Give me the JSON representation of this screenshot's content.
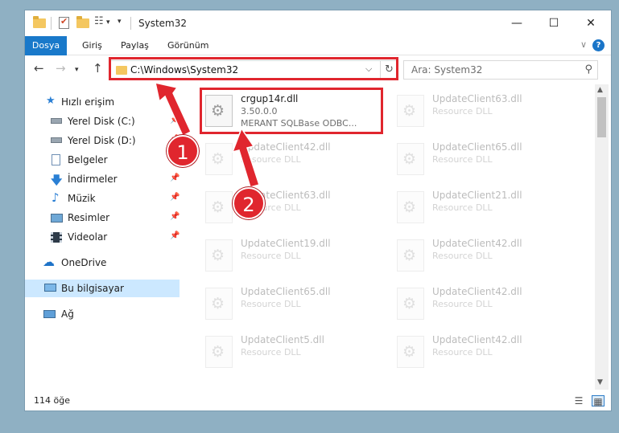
{
  "window": {
    "title": "System32"
  },
  "ribbon": {
    "tabs": [
      "Dosya",
      "Giriş",
      "Paylaş",
      "Görünüm"
    ]
  },
  "address": {
    "path": "C:\\Windows\\System32"
  },
  "search": {
    "placeholder": "Ara: System32"
  },
  "sidebar": {
    "items": [
      {
        "label": "Hızlı erişim",
        "icon": "star-icon"
      },
      {
        "label": "Yerel Disk (C:)",
        "icon": "drive-icon"
      },
      {
        "label": "Yerel Disk (D:)",
        "icon": "drive-icon"
      },
      {
        "label": "Belgeler",
        "icon": "documents-icon"
      },
      {
        "label": "İndirmeler",
        "icon": "download-icon"
      },
      {
        "label": "Müzik",
        "icon": "music-icon"
      },
      {
        "label": "Resimler",
        "icon": "pictures-icon"
      },
      {
        "label": "Videolar",
        "icon": "videos-icon"
      },
      {
        "label": "OneDrive",
        "icon": "cloud-icon"
      },
      {
        "label": "Bu bilgisayar",
        "icon": "computer-icon"
      },
      {
        "label": "Ağ",
        "icon": "network-icon"
      }
    ]
  },
  "files": [
    {
      "name": "crgup14r.dll",
      "version": "3.50.0.0",
      "desc": "MERANT SQLBase ODBC..."
    },
    {
      "name": "UpdateClient63.dll",
      "desc": "Resource DLL"
    },
    {
      "name": "UpdateClient42.dll",
      "desc": "Resource DLL"
    },
    {
      "name": "UpdateClient65.dll",
      "desc": "Resource DLL"
    },
    {
      "name": "UpdateClient63.dll",
      "desc": "Resource DLL"
    },
    {
      "name": "UpdateClient21.dll",
      "desc": "Resource DLL"
    },
    {
      "name": "UpdateClient19.dll",
      "desc": "Resource DLL"
    },
    {
      "name": "UpdateClient42.dll",
      "desc": "Resource DLL"
    },
    {
      "name": "UpdateClient65.dll",
      "desc": "Resource DLL"
    },
    {
      "name": "UpdateClient42.dll",
      "desc": "Resource DLL"
    },
    {
      "name": "UpdateClient5.dll",
      "desc": "Resource DLL"
    },
    {
      "name": "UpdateClient42.dll",
      "desc": "Resource DLL"
    }
  ],
  "status": {
    "count": "114 öğe"
  },
  "callouts": [
    "1",
    "2"
  ],
  "colors": {
    "accent": "#1979ca",
    "annotation": "#e0262e",
    "selection": "#cce8ff"
  }
}
